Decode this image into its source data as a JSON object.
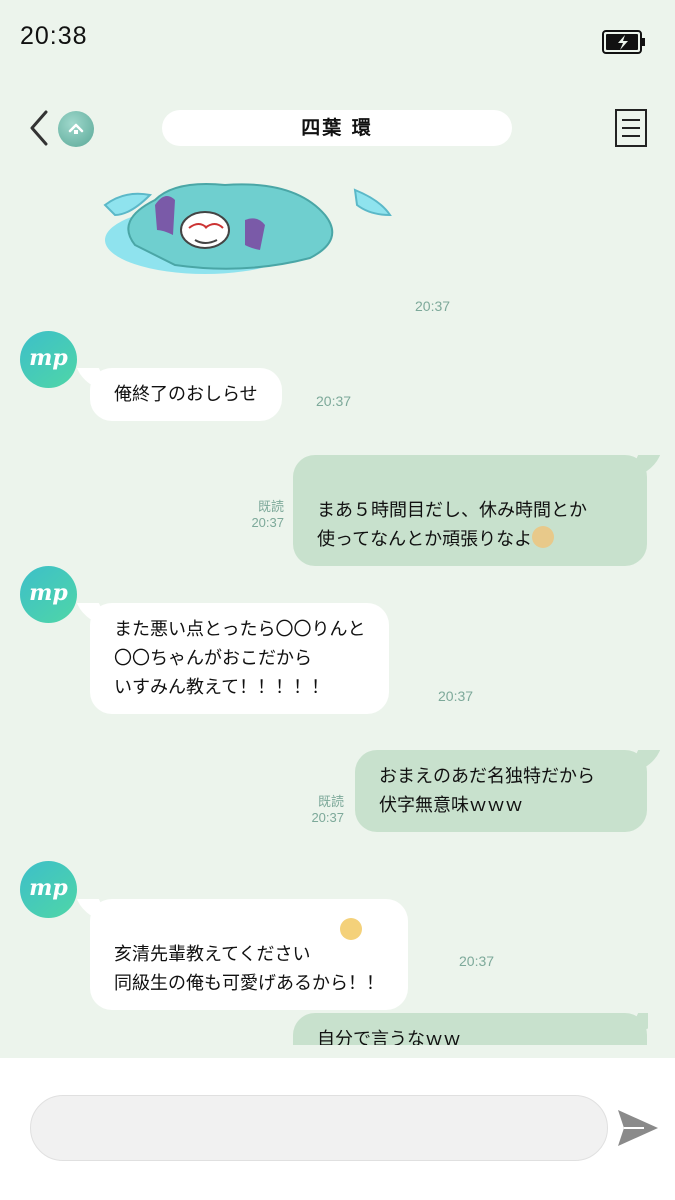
{
  "status": {
    "time": "20:38"
  },
  "header": {
    "title": "四葉 環",
    "icons": [
      "back-icon",
      "home-up-icon",
      "menu-icon"
    ]
  },
  "sticker": {
    "time": "20:37"
  },
  "messages": [
    {
      "side": "in",
      "avatar": "mp",
      "text": "俺終了のおしらせ",
      "time": "20:37"
    },
    {
      "side": "out",
      "text": "まあ５時間目だし、休み時間とか\n使ってなんとか頑張りなよ",
      "read": "既読",
      "time": "20:37"
    },
    {
      "side": "in",
      "avatar": "mp",
      "text": "また悪い点とったら〇〇りんと\n〇〇ちゃんがおこだから\nいすみん教えて！！！！！",
      "time": "20:37"
    },
    {
      "side": "out",
      "text": "おまえのあだ名独特だから\n伏字無意味ｗｗｗ",
      "read": "既読",
      "time": "20:37"
    },
    {
      "side": "in",
      "avatar": "mp",
      "text": "亥清先輩教えてください\n同級生の俺も可愛げあるから！！",
      "time": "20:37"
    },
    {
      "side": "out",
      "text": "自分で言うなｗｗ"
    }
  ],
  "input": {
    "placeholder": ""
  },
  "colors": {
    "background": "#ecf4ec",
    "outgoing": "#c8e1cd",
    "incoming": "#ffffff",
    "accent": "#4fd6a7"
  }
}
